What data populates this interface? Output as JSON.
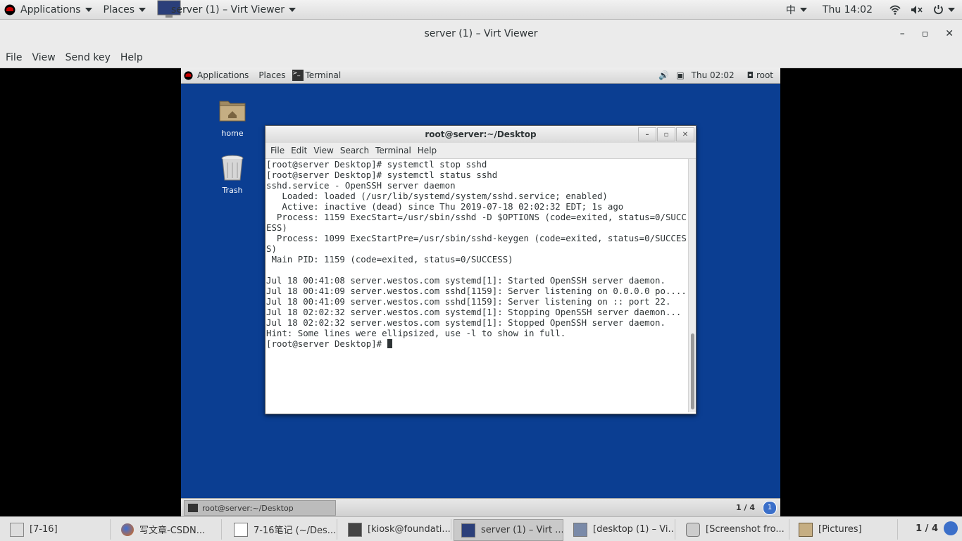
{
  "host_topbar": {
    "applications": "Applications",
    "places": "Places",
    "window_title": "server (1) – Virt Viewer",
    "input_method": "中",
    "clock": "Thu 14:02"
  },
  "viewer": {
    "title": "server (1) – Virt Viewer",
    "menu": [
      "File",
      "View",
      "Send key",
      "Help"
    ]
  },
  "guest": {
    "topbar": {
      "applications": "Applications",
      "places": "Places",
      "task": "Terminal",
      "clock": "Thu 02:02",
      "user": "root"
    },
    "desktop_icons": {
      "home": "home",
      "trash": "Trash"
    },
    "terminal": {
      "title": "root@server:~/Desktop",
      "menu": [
        "File",
        "Edit",
        "View",
        "Search",
        "Terminal",
        "Help"
      ],
      "lines": [
        "[root@server Desktop]# systemctl stop sshd",
        "[root@server Desktop]# systemctl status sshd",
        "sshd.service - OpenSSH server daemon",
        "   Loaded: loaded (/usr/lib/systemd/system/sshd.service; enabled)",
        "   Active: inactive (dead) since Thu 2019-07-18 02:02:32 EDT; 1s ago",
        "  Process: 1159 ExecStart=/usr/sbin/sshd -D $OPTIONS (code=exited, status=0/SUCC",
        "ESS)",
        "  Process: 1099 ExecStartPre=/usr/sbin/sshd-keygen (code=exited, status=0/SUCCES",
        "S)",
        " Main PID: 1159 (code=exited, status=0/SUCCESS)",
        "",
        "Jul 18 00:41:08 server.westos.com systemd[1]: Started OpenSSH server daemon.",
        "Jul 18 00:41:09 server.westos.com sshd[1159]: Server listening on 0.0.0.0 po....",
        "Jul 18 00:41:09 server.westos.com sshd[1159]: Server listening on :: port 22.",
        "Jul 18 02:02:32 server.westos.com systemd[1]: Stopping OpenSSH server daemon...",
        "Jul 18 02:02:32 server.westos.com systemd[1]: Stopped OpenSSH server daemon.",
        "Hint: Some lines were ellipsized, use -l to show in full."
      ],
      "prompt": "[root@server Desktop]# "
    },
    "bottom": {
      "task": "root@server:~/Desktop",
      "workspace": "1 / 4",
      "notification": "1"
    }
  },
  "host_taskbar": {
    "items": [
      "[7-16]",
      "写文章-CSDN...",
      "7-16笔记 (~/Des...",
      "[kiosk@foundati...",
      "server (1) – Virt ...",
      "[desktop (1) – Vi...",
      "[Screenshot fro...",
      "[Pictures]"
    ],
    "workspace": "1 / 4"
  }
}
